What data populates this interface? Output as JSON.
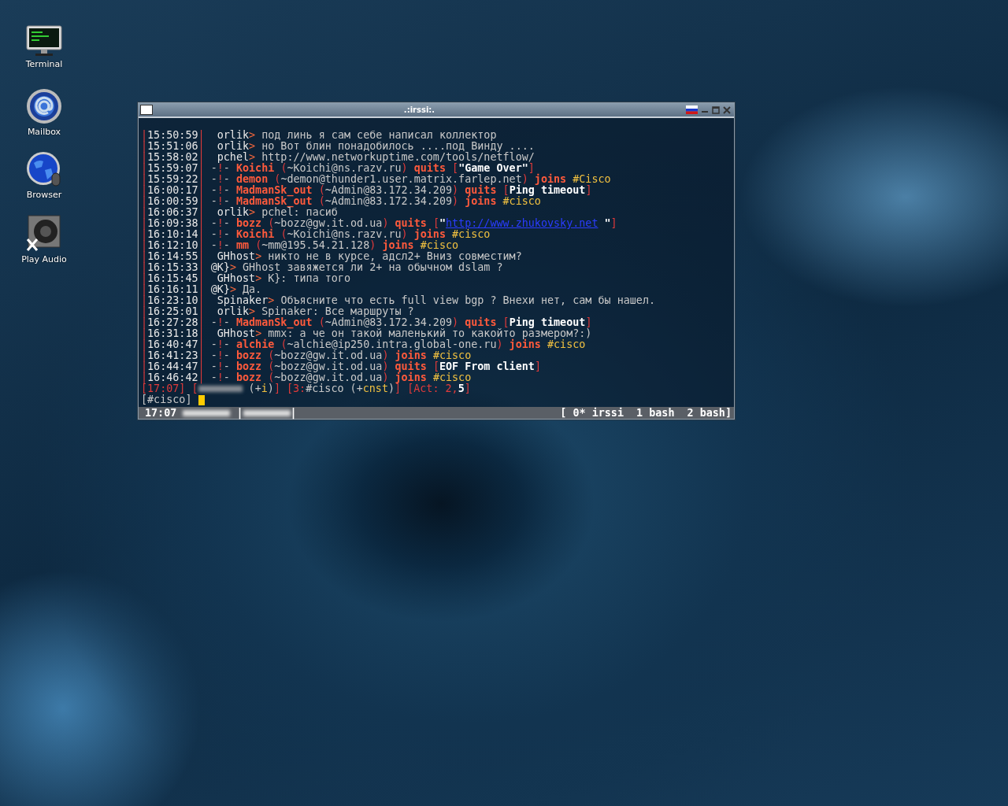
{
  "desktop_icons": [
    {
      "kind": "terminal",
      "label": "Terminal"
    },
    {
      "kind": "mail",
      "label": "Mailbox"
    },
    {
      "kind": "browser",
      "label": "Browser"
    },
    {
      "kind": "audio",
      "label": "Play Audio"
    }
  ],
  "window": {
    "title": ".:irssi:.",
    "lines": [
      {
        "parts": [
          {
            "kind": "sep",
            "text": "|"
          },
          {
            "kind": "time",
            "text": "15:50:59"
          },
          {
            "kind": "sep",
            "text": "|"
          },
          {
            "kind": "nick",
            "text": "  orlik"
          },
          {
            "kind": "arrow",
            "text": "> "
          },
          {
            "kind": "plain",
            "text": "под линь я сам себе написал коллектор"
          }
        ]
      },
      {
        "parts": [
          {
            "kind": "sep",
            "text": "|"
          },
          {
            "kind": "time",
            "text": "15:51:06"
          },
          {
            "kind": "sep",
            "text": "|"
          },
          {
            "kind": "nick",
            "text": "  orlik"
          },
          {
            "kind": "arrow",
            "text": "> "
          },
          {
            "kind": "plain",
            "text": "но Вот блин понадобилось ....под Винду ...."
          }
        ]
      },
      {
        "parts": [
          {
            "kind": "sep",
            "text": "|"
          },
          {
            "kind": "time",
            "text": "15:58:02"
          },
          {
            "kind": "sep",
            "text": "|"
          },
          {
            "kind": "nick",
            "text": "  pchel"
          },
          {
            "kind": "arrow",
            "text": "> "
          },
          {
            "kind": "plain",
            "text": "http://www.networkuptime.com/tools/netflow/"
          }
        ]
      },
      {
        "parts": [
          {
            "kind": "sep",
            "text": "|"
          },
          {
            "kind": "time",
            "text": "15:59:07"
          },
          {
            "kind": "sep",
            "text": "|"
          },
          {
            "kind": "plain",
            "text": " -"
          },
          {
            "kind": "sep",
            "text": "!"
          },
          {
            "kind": "plain",
            "text": "- "
          },
          {
            "kind": "action",
            "text": "Koichi "
          },
          {
            "kind": "sep",
            "text": "("
          },
          {
            "kind": "plain",
            "text": "~Koichi@ns.razv.ru"
          },
          {
            "kind": "sep",
            "text": ") "
          },
          {
            "kind": "action",
            "text": "quits "
          },
          {
            "kind": "sep",
            "text": "["
          },
          {
            "kind": "bold",
            "text": "\"Game Over\""
          },
          {
            "kind": "sep",
            "text": "]"
          }
        ]
      },
      {
        "parts": [
          {
            "kind": "sep",
            "text": "|"
          },
          {
            "kind": "time",
            "text": "15:59:22"
          },
          {
            "kind": "sep",
            "text": "|"
          },
          {
            "kind": "plain",
            "text": " -"
          },
          {
            "kind": "sep",
            "text": "!"
          },
          {
            "kind": "plain",
            "text": "- "
          },
          {
            "kind": "action",
            "text": "demon "
          },
          {
            "kind": "sep",
            "text": "("
          },
          {
            "kind": "plain",
            "text": "~demon@thunder1.user.matrix.farlep.net"
          },
          {
            "kind": "sep",
            "text": ") "
          },
          {
            "kind": "action",
            "text": "joins "
          },
          {
            "kind": "chan",
            "text": "#Cisco"
          }
        ]
      },
      {
        "parts": [
          {
            "kind": "sep",
            "text": "|"
          },
          {
            "kind": "time",
            "text": "16:00:17"
          },
          {
            "kind": "sep",
            "text": "|"
          },
          {
            "kind": "plain",
            "text": " -"
          },
          {
            "kind": "sep",
            "text": "!"
          },
          {
            "kind": "plain",
            "text": "- "
          },
          {
            "kind": "action",
            "text": "MadmanSk_out "
          },
          {
            "kind": "sep",
            "text": "("
          },
          {
            "kind": "plain",
            "text": "~Admin@83.172.34.209"
          },
          {
            "kind": "sep",
            "text": ") "
          },
          {
            "kind": "action",
            "text": "quits "
          },
          {
            "kind": "sep",
            "text": "["
          },
          {
            "kind": "bold",
            "text": "Ping timeout"
          },
          {
            "kind": "sep",
            "text": "]"
          }
        ]
      },
      {
        "parts": [
          {
            "kind": "sep",
            "text": "|"
          },
          {
            "kind": "time",
            "text": "16:00:59"
          },
          {
            "kind": "sep",
            "text": "|"
          },
          {
            "kind": "plain",
            "text": " -"
          },
          {
            "kind": "sep",
            "text": "!"
          },
          {
            "kind": "plain",
            "text": "- "
          },
          {
            "kind": "action",
            "text": "MadmanSk_out "
          },
          {
            "kind": "sep",
            "text": "("
          },
          {
            "kind": "plain",
            "text": "~Admin@83.172.34.209"
          },
          {
            "kind": "sep",
            "text": ") "
          },
          {
            "kind": "action",
            "text": "joins "
          },
          {
            "kind": "chan",
            "text": "#cisco"
          }
        ]
      },
      {
        "parts": [
          {
            "kind": "sep",
            "text": "|"
          },
          {
            "kind": "time",
            "text": "16:06:37"
          },
          {
            "kind": "sep",
            "text": "|"
          },
          {
            "kind": "nick",
            "text": "  orlik"
          },
          {
            "kind": "arrow",
            "text": "> "
          },
          {
            "kind": "plain",
            "text": "pchel: пасиб"
          }
        ]
      },
      {
        "parts": [
          {
            "kind": "sep",
            "text": "|"
          },
          {
            "kind": "time",
            "text": "16:09:38"
          },
          {
            "kind": "sep",
            "text": "|"
          },
          {
            "kind": "plain",
            "text": " -"
          },
          {
            "kind": "sep",
            "text": "!"
          },
          {
            "kind": "plain",
            "text": "- "
          },
          {
            "kind": "action",
            "text": "bozz "
          },
          {
            "kind": "sep",
            "text": "("
          },
          {
            "kind": "plain",
            "text": "~bozz@gw.it.od.ua"
          },
          {
            "kind": "sep",
            "text": ") "
          },
          {
            "kind": "action",
            "text": "quits "
          },
          {
            "kind": "sep",
            "text": "["
          },
          {
            "kind": "bold",
            "text": "\""
          },
          {
            "kind": "url",
            "text": "http://www.zhukovsky.net"
          },
          {
            "kind": "bold",
            "text": " \""
          },
          {
            "kind": "sep",
            "text": "]"
          }
        ]
      },
      {
        "parts": [
          {
            "kind": "sep",
            "text": "|"
          },
          {
            "kind": "time",
            "text": "16:10:14"
          },
          {
            "kind": "sep",
            "text": "|"
          },
          {
            "kind": "plain",
            "text": " -"
          },
          {
            "kind": "sep",
            "text": "!"
          },
          {
            "kind": "plain",
            "text": "- "
          },
          {
            "kind": "action",
            "text": "Koichi "
          },
          {
            "kind": "sep",
            "text": "("
          },
          {
            "kind": "plain",
            "text": "~Koichi@ns.razv.ru"
          },
          {
            "kind": "sep",
            "text": ") "
          },
          {
            "kind": "action",
            "text": "joins "
          },
          {
            "kind": "chan",
            "text": "#cisco"
          }
        ]
      },
      {
        "parts": [
          {
            "kind": "sep",
            "text": "|"
          },
          {
            "kind": "time",
            "text": "16:12:10"
          },
          {
            "kind": "sep",
            "text": "|"
          },
          {
            "kind": "plain",
            "text": " -"
          },
          {
            "kind": "sep",
            "text": "!"
          },
          {
            "kind": "plain",
            "text": "- "
          },
          {
            "kind": "action",
            "text": "mm "
          },
          {
            "kind": "sep",
            "text": "("
          },
          {
            "kind": "plain",
            "text": "~mm@195.54.21.128"
          },
          {
            "kind": "sep",
            "text": ") "
          },
          {
            "kind": "action",
            "text": "joins "
          },
          {
            "kind": "chan",
            "text": "#cisco"
          }
        ]
      },
      {
        "parts": [
          {
            "kind": "sep",
            "text": "|"
          },
          {
            "kind": "time",
            "text": "16:14:55"
          },
          {
            "kind": "sep",
            "text": "|"
          },
          {
            "kind": "nick",
            "text": "  GHhost"
          },
          {
            "kind": "arrow",
            "text": "> "
          },
          {
            "kind": "plain",
            "text": "никто не в курсе, адсл2+ Вниз совместим?"
          }
        ]
      },
      {
        "parts": [
          {
            "kind": "sep",
            "text": "|"
          },
          {
            "kind": "time",
            "text": "16:15:33"
          },
          {
            "kind": "sep",
            "text": "|"
          },
          {
            "kind": "nick",
            "text": " @K}"
          },
          {
            "kind": "arrow",
            "text": "> "
          },
          {
            "kind": "plain",
            "text": "GHhost завяжется ли 2+ на обычном dslam ?"
          }
        ]
      },
      {
        "parts": [
          {
            "kind": "sep",
            "text": "|"
          },
          {
            "kind": "time",
            "text": "16:15:45"
          },
          {
            "kind": "sep",
            "text": "|"
          },
          {
            "kind": "nick",
            "text": "  GHhost"
          },
          {
            "kind": "arrow",
            "text": "> "
          },
          {
            "kind": "plain",
            "text": "K}: типа того"
          }
        ]
      },
      {
        "parts": [
          {
            "kind": "sep",
            "text": "|"
          },
          {
            "kind": "time",
            "text": "16:16:11"
          },
          {
            "kind": "sep",
            "text": "|"
          },
          {
            "kind": "nick",
            "text": " @K}"
          },
          {
            "kind": "arrow",
            "text": "> "
          },
          {
            "kind": "plain",
            "text": "Да."
          }
        ]
      },
      {
        "parts": [
          {
            "kind": "sep",
            "text": "|"
          },
          {
            "kind": "time",
            "text": "16:23:10"
          },
          {
            "kind": "sep",
            "text": "|"
          },
          {
            "kind": "nick",
            "text": "  Spinaker"
          },
          {
            "kind": "arrow",
            "text": "> "
          },
          {
            "kind": "plain",
            "text": "Объясните что есть full view bgp ? Внехи нет, сам бы нашел."
          }
        ]
      },
      {
        "parts": [
          {
            "kind": "sep",
            "text": "|"
          },
          {
            "kind": "time",
            "text": "16:25:01"
          },
          {
            "kind": "sep",
            "text": "|"
          },
          {
            "kind": "nick",
            "text": "  orlik"
          },
          {
            "kind": "arrow",
            "text": "> "
          },
          {
            "kind": "plain",
            "text": "Spinaker: Все маршруты ?"
          }
        ]
      },
      {
        "parts": [
          {
            "kind": "sep",
            "text": "|"
          },
          {
            "kind": "time",
            "text": "16:27:28"
          },
          {
            "kind": "sep",
            "text": "|"
          },
          {
            "kind": "plain",
            "text": " -"
          },
          {
            "kind": "sep",
            "text": "!"
          },
          {
            "kind": "plain",
            "text": "- "
          },
          {
            "kind": "action",
            "text": "MadmanSk_out "
          },
          {
            "kind": "sep",
            "text": "("
          },
          {
            "kind": "plain",
            "text": "~Admin@83.172.34.209"
          },
          {
            "kind": "sep",
            "text": ") "
          },
          {
            "kind": "action",
            "text": "quits "
          },
          {
            "kind": "sep",
            "text": "["
          },
          {
            "kind": "bold",
            "text": "Ping timeout"
          },
          {
            "kind": "sep",
            "text": "]"
          }
        ]
      },
      {
        "parts": [
          {
            "kind": "sep",
            "text": "|"
          },
          {
            "kind": "time",
            "text": "16:31:18"
          },
          {
            "kind": "sep",
            "text": "|"
          },
          {
            "kind": "nick",
            "text": "  GHhost"
          },
          {
            "kind": "arrow",
            "text": "> "
          },
          {
            "kind": "plain",
            "text": "mmx: а че он такой маленький то какойто размером?:)"
          }
        ]
      },
      {
        "parts": [
          {
            "kind": "sep",
            "text": "|"
          },
          {
            "kind": "time",
            "text": "16:40:47"
          },
          {
            "kind": "sep",
            "text": "|"
          },
          {
            "kind": "plain",
            "text": " -"
          },
          {
            "kind": "sep",
            "text": "!"
          },
          {
            "kind": "plain",
            "text": "- "
          },
          {
            "kind": "action",
            "text": "alchie "
          },
          {
            "kind": "sep",
            "text": "("
          },
          {
            "kind": "plain",
            "text": "~alchie@ip250.intra.global-one.ru"
          },
          {
            "kind": "sep",
            "text": ") "
          },
          {
            "kind": "action",
            "text": "joins "
          },
          {
            "kind": "chan",
            "text": "#cisco"
          }
        ]
      },
      {
        "parts": [
          {
            "kind": "sep",
            "text": "|"
          },
          {
            "kind": "time",
            "text": "16:41:23"
          },
          {
            "kind": "sep",
            "text": "|"
          },
          {
            "kind": "plain",
            "text": " -"
          },
          {
            "kind": "sep",
            "text": "!"
          },
          {
            "kind": "plain",
            "text": "- "
          },
          {
            "kind": "action",
            "text": "bozz "
          },
          {
            "kind": "sep",
            "text": "("
          },
          {
            "kind": "plain",
            "text": "~bozz@gw.it.od.ua"
          },
          {
            "kind": "sep",
            "text": ") "
          },
          {
            "kind": "action",
            "text": "joins "
          },
          {
            "kind": "chan",
            "text": "#cisco"
          }
        ]
      },
      {
        "parts": [
          {
            "kind": "sep",
            "text": "|"
          },
          {
            "kind": "time",
            "text": "16:44:47"
          },
          {
            "kind": "sep",
            "text": "|"
          },
          {
            "kind": "plain",
            "text": " -"
          },
          {
            "kind": "sep",
            "text": "!"
          },
          {
            "kind": "plain",
            "text": "- "
          },
          {
            "kind": "action",
            "text": "bozz "
          },
          {
            "kind": "sep",
            "text": "("
          },
          {
            "kind": "plain",
            "text": "~bozz@gw.it.od.ua"
          },
          {
            "kind": "sep",
            "text": ") "
          },
          {
            "kind": "action",
            "text": "quits "
          },
          {
            "kind": "sep",
            "text": "["
          },
          {
            "kind": "bold",
            "text": "EOF From client"
          },
          {
            "kind": "sep",
            "text": "]"
          }
        ]
      },
      {
        "parts": [
          {
            "kind": "sep",
            "text": "|"
          },
          {
            "kind": "time",
            "text": "16:46:42"
          },
          {
            "kind": "sep",
            "text": "|"
          },
          {
            "kind": "plain",
            "text": " -"
          },
          {
            "kind": "sep",
            "text": "!"
          },
          {
            "kind": "plain",
            "text": "- "
          },
          {
            "kind": "action",
            "text": "bozz "
          },
          {
            "kind": "sep",
            "text": "("
          },
          {
            "kind": "plain",
            "text": "~bozz@gw.it.od.ua"
          },
          {
            "kind": "sep",
            "text": ") "
          },
          {
            "kind": "action",
            "text": "joins "
          },
          {
            "kind": "chan",
            "text": "#cisco"
          }
        ]
      }
    ],
    "status_line": [
      {
        "kind": "sep",
        "text": "[17:07] ["
      },
      {
        "kind": "blurred"
      },
      {
        "kind": "plain",
        "text": " (+"
      },
      {
        "kind": "chan",
        "text": "i"
      },
      {
        "kind": "plain",
        "text": ")"
      },
      {
        "kind": "sep",
        "text": "] [3:"
      },
      {
        "kind": "plain",
        "text": "#cisco (+"
      },
      {
        "kind": "chan",
        "text": "cnst"
      },
      {
        "kind": "plain",
        "text": ")"
      },
      {
        "kind": "sep",
        "text": "] [Act: 2,"
      },
      {
        "kind": "bold",
        "text": "5"
      },
      {
        "kind": "sep",
        "text": "]"
      }
    ],
    "prompt": "[#cisco]",
    "screen_bar": {
      "left": [
        {
          "kind": "bold",
          "text": "17:07 "
        },
        {
          "kind": "blurred"
        },
        {
          "kind": "bold",
          "text": " |"
        },
        {
          "kind": "blurred"
        },
        {
          "kind": "bold",
          "text": "|"
        }
      ],
      "right": "[ 0* irssi  1 bash  2 bash]"
    }
  }
}
